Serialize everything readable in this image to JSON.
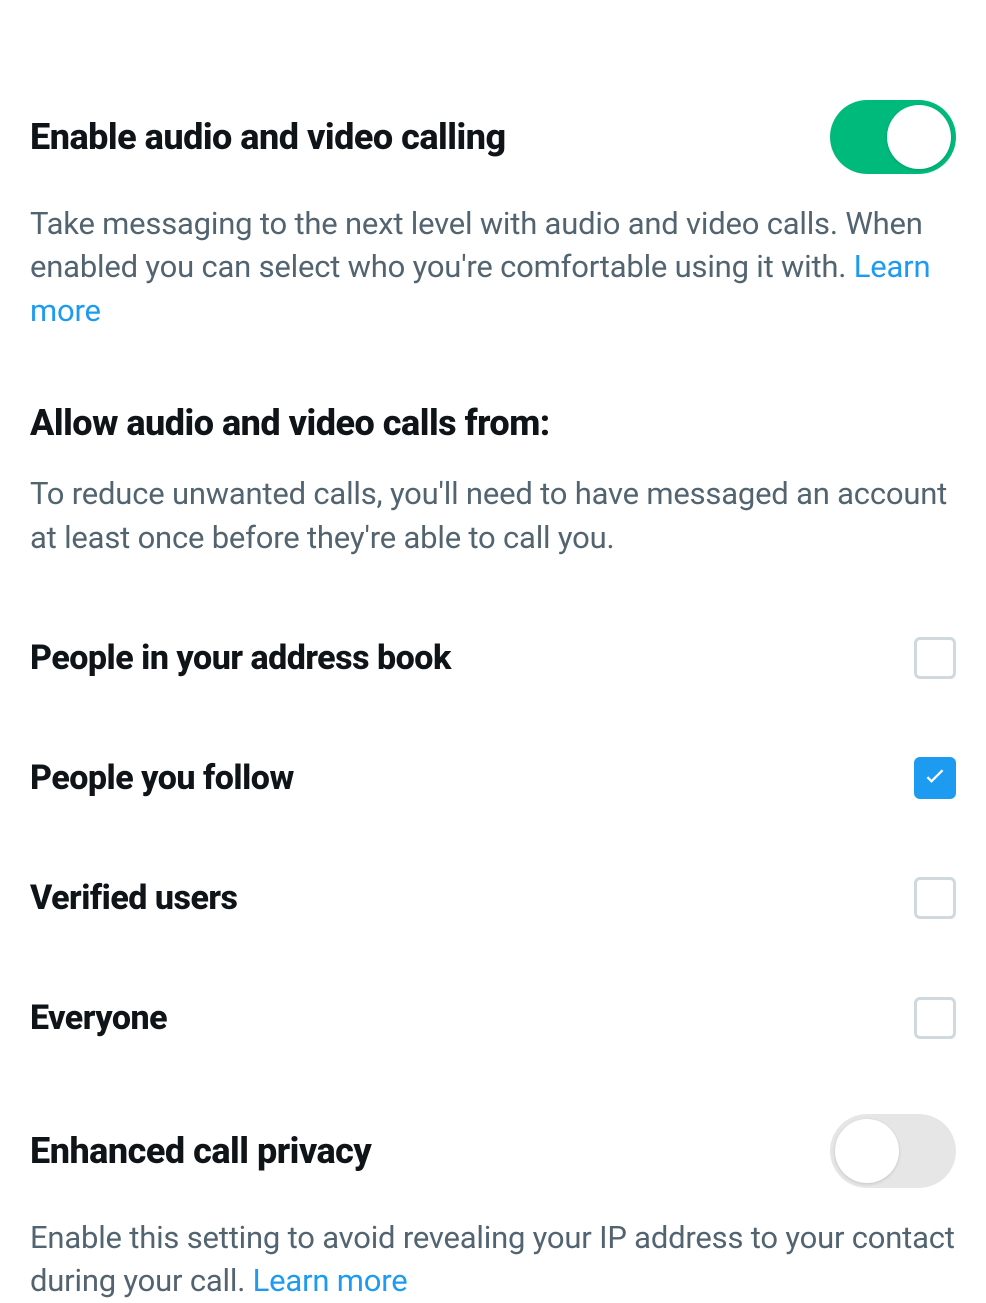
{
  "enable_calling": {
    "title": "Enable audio and video calling",
    "description": "Take messaging to the next level with audio and video calls. When enabled you can select who you're comfortable using it with. ",
    "learn_more": "Learn more",
    "enabled": true
  },
  "allow_from": {
    "title": "Allow audio and video calls from:",
    "description": "To reduce unwanted calls, you'll need to have messaged an account at least once before they're able to call you.",
    "options": [
      {
        "label": "People in your address book",
        "checked": false
      },
      {
        "label": "People you follow",
        "checked": true
      },
      {
        "label": "Verified users",
        "checked": false
      },
      {
        "label": "Everyone",
        "checked": false
      }
    ]
  },
  "enhanced_privacy": {
    "title": "Enhanced call privacy",
    "description": "Enable this setting to avoid revealing your IP address to your contact during your call. ",
    "learn_more": "Learn more",
    "enabled": false
  }
}
